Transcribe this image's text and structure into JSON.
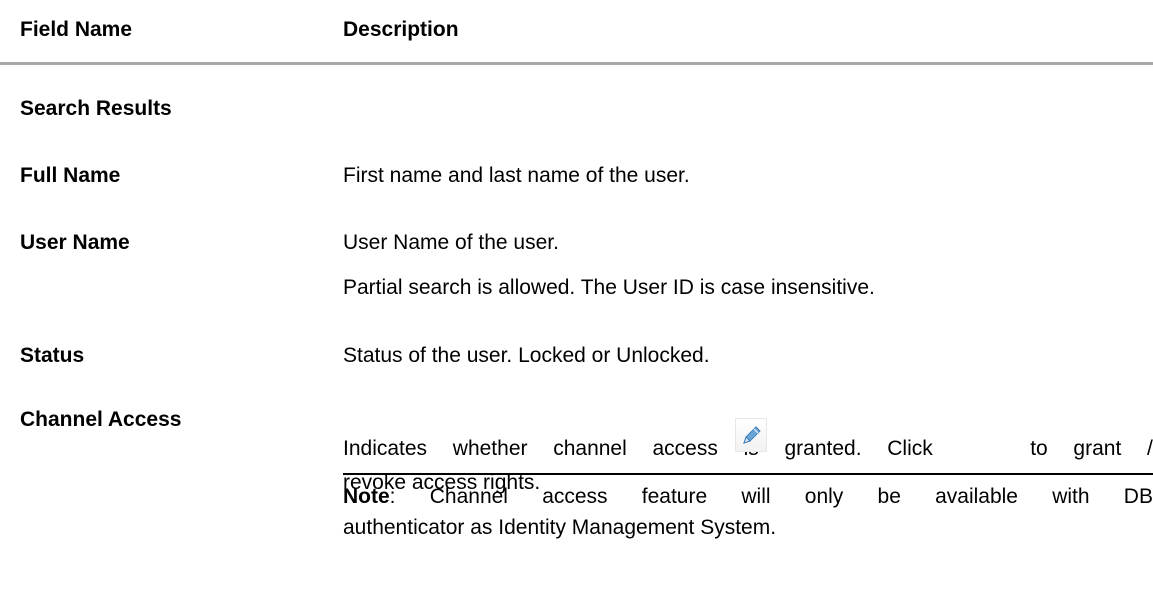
{
  "table": {
    "headers": [
      "Field Name",
      "Description"
    ],
    "section_title": "Search Results",
    "rows": [
      {
        "field": "Full Name",
        "description": [
          "First name and last name of the user."
        ]
      },
      {
        "field": "User Name",
        "description": [
          "User Name of the user.",
          "Partial search is allowed. The User ID is case insensitive."
        ]
      },
      {
        "field": "Status",
        "description": [
          "Status of the user. Locked or Unlocked."
        ]
      },
      {
        "field": "Channel Access",
        "description_words_line1": [
          "Indicates",
          "whether",
          "channel",
          "access",
          "is",
          "granted.",
          "Click",
          "[edit-icon]",
          "to",
          "grant",
          "/"
        ],
        "description_line2": "revoke access rights.",
        "note": {
          "label": "Note",
          "text_line1_words": [
            ":",
            "Channel",
            "access",
            "feature",
            "will",
            "only",
            "be",
            "available",
            "with",
            "DB"
          ],
          "text_line2": "authenticator as Identity Management System."
        }
      }
    ]
  }
}
